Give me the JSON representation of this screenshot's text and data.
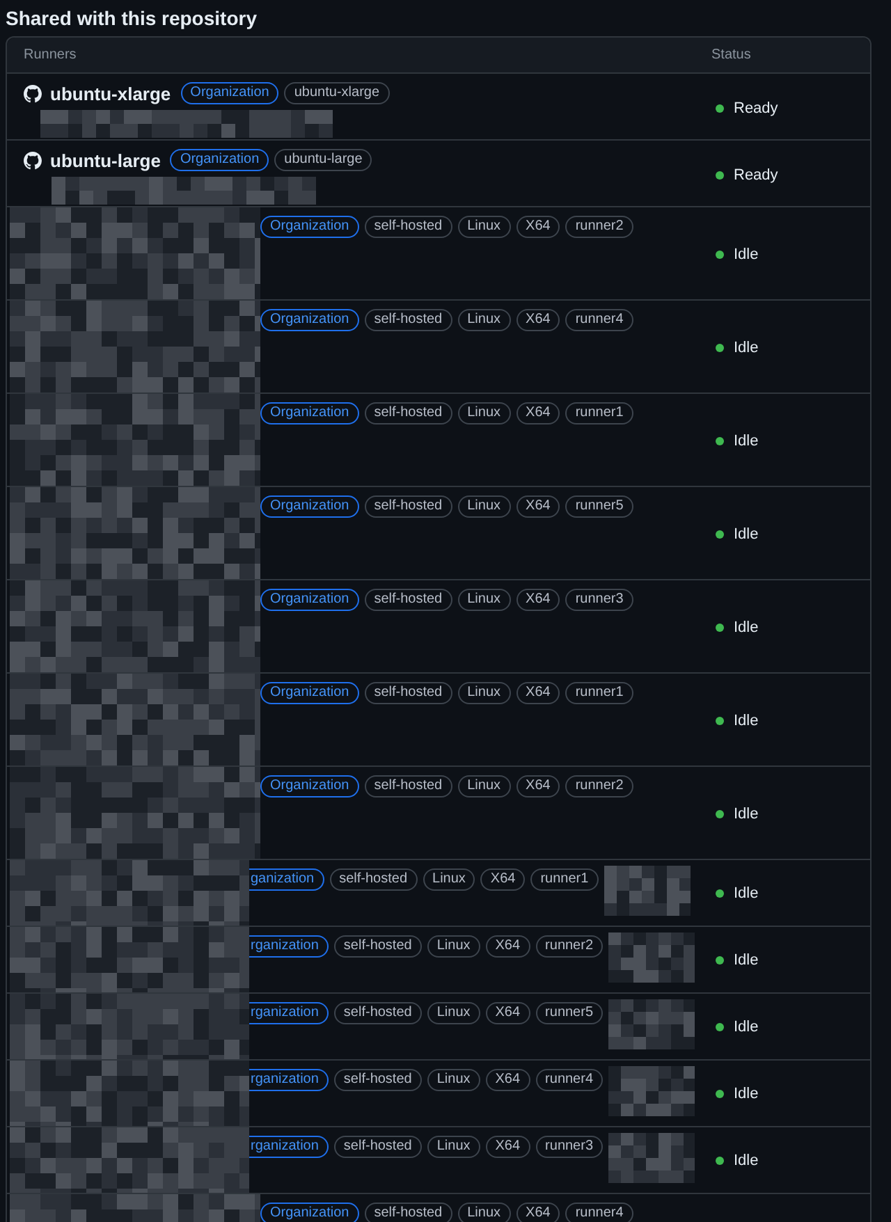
{
  "section_title": "Shared with this repository",
  "table": {
    "columns": [
      "Runners",
      "Status"
    ],
    "rows": [
      {
        "kind": "hosted",
        "name": "ubuntu-xlarge",
        "org_label": "Organization",
        "org_cut": false,
        "labels": [
          "ubuntu-xlarge"
        ],
        "status": "Ready"
      },
      {
        "kind": "hosted",
        "name": "ubuntu-large",
        "org_label": "Organization",
        "org_cut": false,
        "labels": [
          "ubuntu-large"
        ],
        "status": "Ready"
      },
      {
        "kind": "self",
        "org_label": "Organization",
        "org_cut": false,
        "labels": [
          "self-hosted",
          "Linux",
          "X64",
          "runner2"
        ],
        "status": "Idle"
      },
      {
        "kind": "self",
        "org_label": "Organization",
        "org_cut": false,
        "labels": [
          "self-hosted",
          "Linux",
          "X64",
          "runner4"
        ],
        "status": "Idle"
      },
      {
        "kind": "self",
        "org_label": "Organization",
        "org_cut": false,
        "labels": [
          "self-hosted",
          "Linux",
          "X64",
          "runner1"
        ],
        "status": "Idle"
      },
      {
        "kind": "self",
        "org_label": "Organization",
        "org_cut": false,
        "labels": [
          "self-hosted",
          "Linux",
          "X64",
          "runner5"
        ],
        "status": "Idle"
      },
      {
        "kind": "self",
        "org_label": "Organization",
        "org_cut": false,
        "labels": [
          "self-hosted",
          "Linux",
          "X64",
          "runner3"
        ],
        "status": "Idle"
      },
      {
        "kind": "self",
        "org_label": "Organization",
        "org_cut": false,
        "labels": [
          "self-hosted",
          "Linux",
          "X64",
          "runner1"
        ],
        "status": "Idle"
      },
      {
        "kind": "self",
        "org_label": "Organization",
        "org_cut": false,
        "labels": [
          "self-hosted",
          "Linux",
          "X64",
          "runner2"
        ],
        "status": "Idle"
      },
      {
        "kind": "compact",
        "org_label": "ganization",
        "org_cut": true,
        "labels": [
          "self-hosted",
          "Linux",
          "X64",
          "runner1"
        ],
        "status": "Idle"
      },
      {
        "kind": "compact",
        "org_label": "rganization",
        "org_cut": true,
        "labels": [
          "self-hosted",
          "Linux",
          "X64",
          "runner2"
        ],
        "status": "Idle"
      },
      {
        "kind": "compact",
        "org_label": "rganization",
        "org_cut": true,
        "labels": [
          "self-hosted",
          "Linux",
          "X64",
          "runner5"
        ],
        "status": "Idle"
      },
      {
        "kind": "compact",
        "org_label": "rganization",
        "org_cut": true,
        "labels": [
          "self-hosted",
          "Linux",
          "X64",
          "runner4"
        ],
        "status": "Idle"
      },
      {
        "kind": "compact",
        "org_label": "rganization",
        "org_cut": true,
        "labels": [
          "self-hosted",
          "Linux",
          "X64",
          "runner3"
        ],
        "status": "Idle"
      },
      {
        "kind": "self",
        "org_label": "Organization",
        "org_cut": false,
        "labels": [
          "self-hosted",
          "Linux",
          "X64",
          "runner4"
        ]
      }
    ]
  }
}
